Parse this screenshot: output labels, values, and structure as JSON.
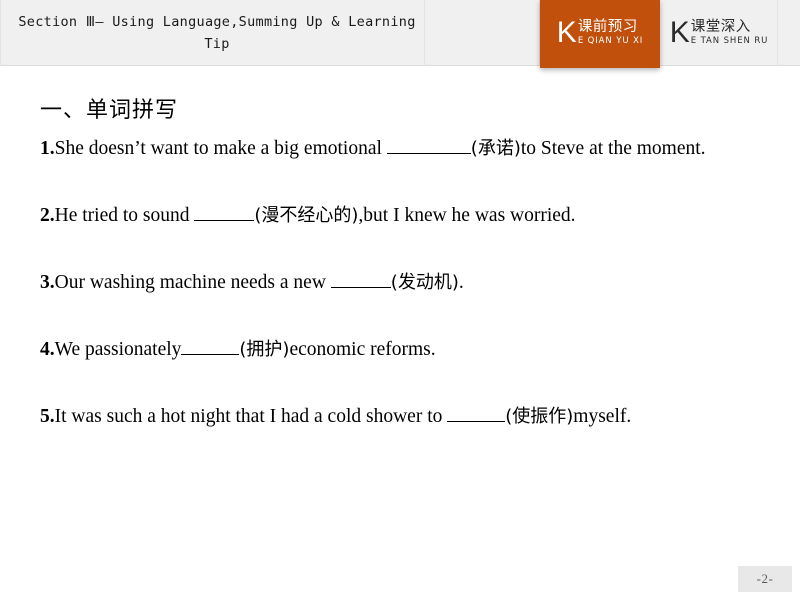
{
  "header": {
    "section_title": "Section Ⅲ— Using Language,Summing Up & Learning Tip",
    "tabs": [
      {
        "key_letter": "K",
        "label_cn": "课前预习",
        "label_pinyin": "E QIAN YU XI",
        "active": true,
        "accent_color": "#c0500c"
      },
      {
        "key_letter": "K",
        "label_cn": "课堂深入",
        "label_pinyin": "E TAN SHEN RU",
        "active": false,
        "accent_color": "#2b2b2b"
      }
    ],
    "background_color": "#f0f0f0"
  },
  "main": {
    "heading": "一、单词拼写",
    "questions": [
      {
        "number": "1.",
        "text_before": "She doesn’t want to make a big emotional ",
        "blank_width": 84,
        "hint": "(承诺)",
        "text_after": "to Steve at the moment."
      },
      {
        "number": "2.",
        "text_before": "He tried to sound ",
        "blank_width": 60,
        "hint": "(漫不经心的)",
        "text_after": ",but I knew he was worried."
      },
      {
        "number": "3.",
        "text_before": "Our washing machine needs a new ",
        "blank_width": 60,
        "hint": "(发动机)",
        "text_after": "."
      },
      {
        "number": "4.",
        "text_before": "We passionately",
        "blank_width": 58,
        "hint": "(拥护)",
        "text_after": "economic reforms."
      },
      {
        "number": "5.",
        "text_before": "It was such a hot night that I had a cold shower to ",
        "blank_width": 58,
        "hint": "(使振作)",
        "text_after": "myself."
      }
    ]
  },
  "footer": {
    "page_number": "-2-"
  }
}
